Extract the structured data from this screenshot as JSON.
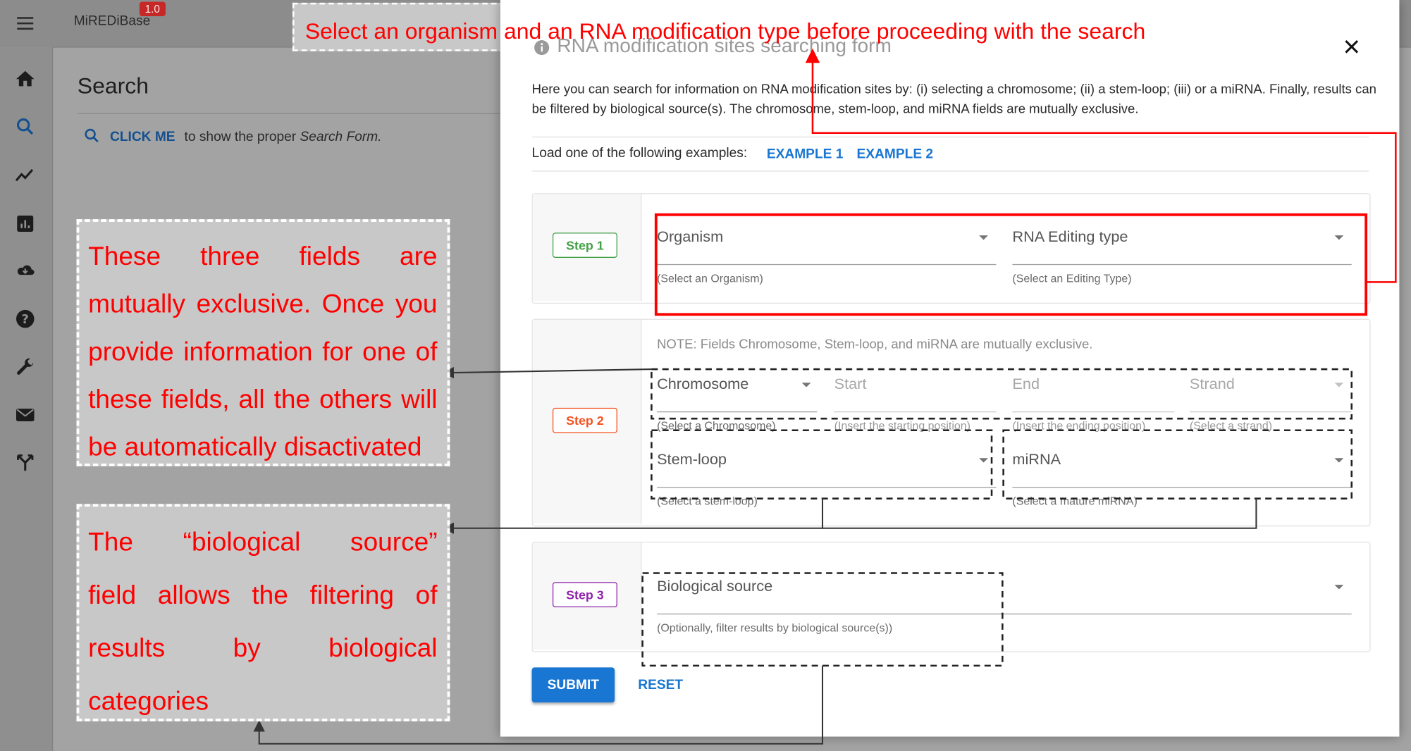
{
  "app": {
    "name": "MiREDiBase",
    "version": "1.0"
  },
  "nav": {
    "items": [
      {
        "icon": "home-icon"
      },
      {
        "icon": "search-icon"
      },
      {
        "icon": "trending-icon"
      },
      {
        "icon": "bar-chart-icon"
      },
      {
        "icon": "cloud-download-icon"
      },
      {
        "icon": "help-icon"
      },
      {
        "icon": "wrench-icon"
      },
      {
        "icon": "mail-icon"
      },
      {
        "icon": "merge-icon"
      }
    ]
  },
  "page": {
    "heading": "Search",
    "click_me": "CLICK ME",
    "click_rest": "to show the proper",
    "click_form": "Search Form."
  },
  "dialog": {
    "title": "RNA modification sites searching form",
    "intro": "Here you can search for information on RNA modification sites by: (i) selecting a chromosome; (ii) a stem-loop; (iii) or a miRNA. Finally, results can be filtered by biological source(s). The chromosome, stem-loop, and miRNA fields are mutually exclusive.",
    "examples_label": "Load one of the following examples:",
    "example1": "EXAMPLE 1",
    "example2": "EXAMPLE 2",
    "step1": {
      "chip": "Step 1",
      "organism_label": "Organism",
      "organism_hint": "(Select an Organism)",
      "editing_label": "RNA Editing type",
      "editing_hint": "(Select an Editing Type)"
    },
    "step2": {
      "chip": "Step 2",
      "note": "NOTE: Fields Chromosome, Stem-loop, and miRNA are mutually exclusive.",
      "chromosome_label": "Chromosome",
      "chromosome_hint": "(Select a Chromosome)",
      "start_label": "Start",
      "start_hint": "(Insert the starting position)",
      "end_label": "End",
      "end_hint": "(Insert the ending position)",
      "strand_label": "Strand",
      "strand_hint": "(Select a strand)",
      "stemloop_label": "Stem-loop",
      "stemloop_hint": "(Select a stem-loop)",
      "mirna_label": "miRNA",
      "mirna_hint": "(Select a mature miRNA)"
    },
    "step3": {
      "chip": "Step 3",
      "bio_label": "Biological source",
      "bio_hint": "(Optionally, filter results by biological source(s))"
    },
    "submit": "SUBMIT",
    "reset": "RESET"
  },
  "annotations": {
    "top_banner": "Select an organism and an RNA modification type before proceeding with the search",
    "callout1_lines": [
      "These three fields are",
      "mutually exclusive. Once you",
      "provide information for one of",
      "these fields, all the others will",
      "be automatically disactivated"
    ],
    "callout2_lines": [
      "The “biological source”",
      "field allows the filtering of",
      "results by biological",
      "categories"
    ]
  },
  "colors": {
    "annotation_red": "#ff0000",
    "primary_blue": "#1976d2",
    "step1_green": "#43a047",
    "step2_orange": "#f4511e",
    "step3_purple": "#8e24aa"
  }
}
